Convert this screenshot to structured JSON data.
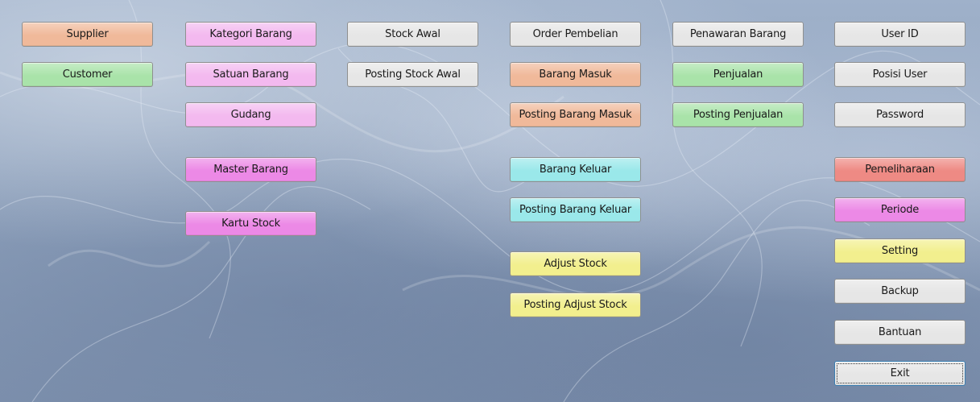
{
  "buttons": [
    {
      "id": "supplier",
      "label": "Supplier",
      "color": "#f0b99a"
    },
    {
      "id": "customer",
      "label": "Customer",
      "color": "#a9e3a9"
    },
    {
      "id": "kategori-barang",
      "label": "Kategori Barang",
      "color": "#f3b9ef"
    },
    {
      "id": "satuan-barang",
      "label": "Satuan Barang",
      "color": "#f3b9ef"
    },
    {
      "id": "gudang",
      "label": "Gudang",
      "color": "#f3b9ef"
    },
    {
      "id": "master-barang",
      "label": "Master Barang",
      "color": "#ec89e6"
    },
    {
      "id": "kartu-stock",
      "label": "Kartu Stock",
      "color": "#ec89e6"
    },
    {
      "id": "stock-awal",
      "label": "Stock Awal",
      "color": "#e6e6e6"
    },
    {
      "id": "posting-stock-awal",
      "label": "Posting Stock Awal",
      "color": "#e6e6e6"
    },
    {
      "id": "order-pembelian",
      "label": "Order Pembelian",
      "color": "#e6e6e6"
    },
    {
      "id": "barang-masuk",
      "label": "Barang Masuk",
      "color": "#f0b99a"
    },
    {
      "id": "posting-barang-masuk",
      "label": "Posting Barang Masuk",
      "color": "#f0b99a"
    },
    {
      "id": "barang-keluar",
      "label": "Barang Keluar",
      "color": "#9ae8ea"
    },
    {
      "id": "posting-barang-keluar",
      "label": "Posting Barang Keluar",
      "color": "#9ae8ea"
    },
    {
      "id": "adjust-stock",
      "label": "Adjust Stock",
      "color": "#f2ef8e"
    },
    {
      "id": "posting-adjust-stock",
      "label": "Posting Adjust Stock",
      "color": "#f2ef8e"
    },
    {
      "id": "penawaran-barang",
      "label": "Penawaran Barang",
      "color": "#e6e6e6"
    },
    {
      "id": "penjualan",
      "label": "Penjualan",
      "color": "#a9e3a9"
    },
    {
      "id": "posting-penjualan",
      "label": "Posting Penjualan",
      "color": "#a9e3a9"
    },
    {
      "id": "user-id",
      "label": "User ID",
      "color": "#e6e6e6"
    },
    {
      "id": "posisi-user",
      "label": "Posisi User",
      "color": "#e6e6e6"
    },
    {
      "id": "password",
      "label": "Password",
      "color": "#e6e6e6"
    },
    {
      "id": "pemeliharaan",
      "label": "Pemeliharaan",
      "color": "#ee8a84"
    },
    {
      "id": "periode",
      "label": "Periode",
      "color": "#ec89e6"
    },
    {
      "id": "setting",
      "label": "Setting",
      "color": "#f2ef8e"
    },
    {
      "id": "backup",
      "label": "Backup",
      "color": "#e6e6e6"
    },
    {
      "id": "bantuan",
      "label": "Bantuan",
      "color": "#e6e6e6"
    },
    {
      "id": "exit",
      "label": "Exit",
      "color": "#e6e6e6"
    }
  ]
}
